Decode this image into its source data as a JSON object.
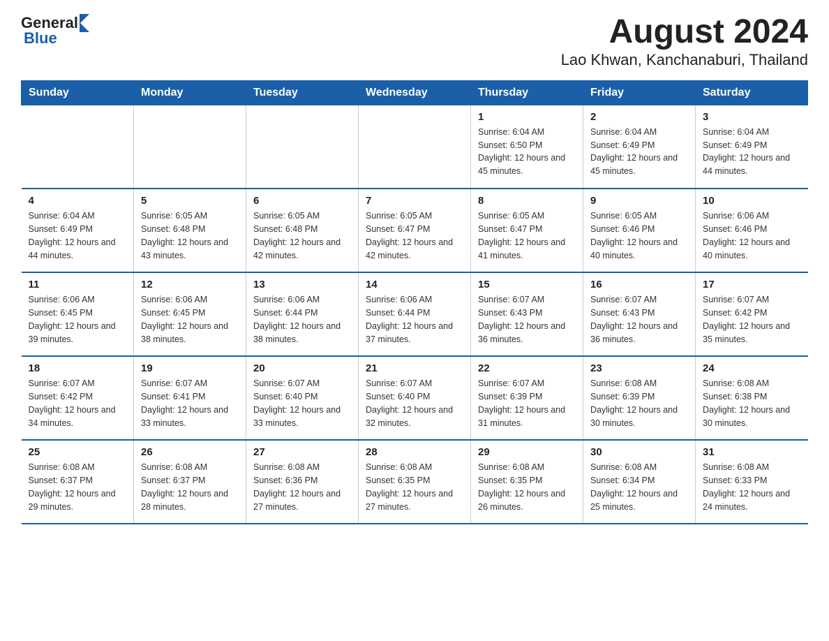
{
  "header": {
    "logo_general": "General",
    "logo_blue": "Blue",
    "title": "August 2024",
    "subtitle": "Lao Khwan, Kanchanaburi, Thailand"
  },
  "days_of_week": [
    "Sunday",
    "Monday",
    "Tuesday",
    "Wednesday",
    "Thursday",
    "Friday",
    "Saturday"
  ],
  "weeks": [
    [
      {
        "day": "",
        "info": ""
      },
      {
        "day": "",
        "info": ""
      },
      {
        "day": "",
        "info": ""
      },
      {
        "day": "",
        "info": ""
      },
      {
        "day": "1",
        "info": "Sunrise: 6:04 AM\nSunset: 6:50 PM\nDaylight: 12 hours and 45 minutes."
      },
      {
        "day": "2",
        "info": "Sunrise: 6:04 AM\nSunset: 6:49 PM\nDaylight: 12 hours and 45 minutes."
      },
      {
        "day": "3",
        "info": "Sunrise: 6:04 AM\nSunset: 6:49 PM\nDaylight: 12 hours and 44 minutes."
      }
    ],
    [
      {
        "day": "4",
        "info": "Sunrise: 6:04 AM\nSunset: 6:49 PM\nDaylight: 12 hours and 44 minutes."
      },
      {
        "day": "5",
        "info": "Sunrise: 6:05 AM\nSunset: 6:48 PM\nDaylight: 12 hours and 43 minutes."
      },
      {
        "day": "6",
        "info": "Sunrise: 6:05 AM\nSunset: 6:48 PM\nDaylight: 12 hours and 42 minutes."
      },
      {
        "day": "7",
        "info": "Sunrise: 6:05 AM\nSunset: 6:47 PM\nDaylight: 12 hours and 42 minutes."
      },
      {
        "day": "8",
        "info": "Sunrise: 6:05 AM\nSunset: 6:47 PM\nDaylight: 12 hours and 41 minutes."
      },
      {
        "day": "9",
        "info": "Sunrise: 6:05 AM\nSunset: 6:46 PM\nDaylight: 12 hours and 40 minutes."
      },
      {
        "day": "10",
        "info": "Sunrise: 6:06 AM\nSunset: 6:46 PM\nDaylight: 12 hours and 40 minutes."
      }
    ],
    [
      {
        "day": "11",
        "info": "Sunrise: 6:06 AM\nSunset: 6:45 PM\nDaylight: 12 hours and 39 minutes."
      },
      {
        "day": "12",
        "info": "Sunrise: 6:06 AM\nSunset: 6:45 PM\nDaylight: 12 hours and 38 minutes."
      },
      {
        "day": "13",
        "info": "Sunrise: 6:06 AM\nSunset: 6:44 PM\nDaylight: 12 hours and 38 minutes."
      },
      {
        "day": "14",
        "info": "Sunrise: 6:06 AM\nSunset: 6:44 PM\nDaylight: 12 hours and 37 minutes."
      },
      {
        "day": "15",
        "info": "Sunrise: 6:07 AM\nSunset: 6:43 PM\nDaylight: 12 hours and 36 minutes."
      },
      {
        "day": "16",
        "info": "Sunrise: 6:07 AM\nSunset: 6:43 PM\nDaylight: 12 hours and 36 minutes."
      },
      {
        "day": "17",
        "info": "Sunrise: 6:07 AM\nSunset: 6:42 PM\nDaylight: 12 hours and 35 minutes."
      }
    ],
    [
      {
        "day": "18",
        "info": "Sunrise: 6:07 AM\nSunset: 6:42 PM\nDaylight: 12 hours and 34 minutes."
      },
      {
        "day": "19",
        "info": "Sunrise: 6:07 AM\nSunset: 6:41 PM\nDaylight: 12 hours and 33 minutes."
      },
      {
        "day": "20",
        "info": "Sunrise: 6:07 AM\nSunset: 6:40 PM\nDaylight: 12 hours and 33 minutes."
      },
      {
        "day": "21",
        "info": "Sunrise: 6:07 AM\nSunset: 6:40 PM\nDaylight: 12 hours and 32 minutes."
      },
      {
        "day": "22",
        "info": "Sunrise: 6:07 AM\nSunset: 6:39 PM\nDaylight: 12 hours and 31 minutes."
      },
      {
        "day": "23",
        "info": "Sunrise: 6:08 AM\nSunset: 6:39 PM\nDaylight: 12 hours and 30 minutes."
      },
      {
        "day": "24",
        "info": "Sunrise: 6:08 AM\nSunset: 6:38 PM\nDaylight: 12 hours and 30 minutes."
      }
    ],
    [
      {
        "day": "25",
        "info": "Sunrise: 6:08 AM\nSunset: 6:37 PM\nDaylight: 12 hours and 29 minutes."
      },
      {
        "day": "26",
        "info": "Sunrise: 6:08 AM\nSunset: 6:37 PM\nDaylight: 12 hours and 28 minutes."
      },
      {
        "day": "27",
        "info": "Sunrise: 6:08 AM\nSunset: 6:36 PM\nDaylight: 12 hours and 27 minutes."
      },
      {
        "day": "28",
        "info": "Sunrise: 6:08 AM\nSunset: 6:35 PM\nDaylight: 12 hours and 27 minutes."
      },
      {
        "day": "29",
        "info": "Sunrise: 6:08 AM\nSunset: 6:35 PM\nDaylight: 12 hours and 26 minutes."
      },
      {
        "day": "30",
        "info": "Sunrise: 6:08 AM\nSunset: 6:34 PM\nDaylight: 12 hours and 25 minutes."
      },
      {
        "day": "31",
        "info": "Sunrise: 6:08 AM\nSunset: 6:33 PM\nDaylight: 12 hours and 24 minutes."
      }
    ]
  ]
}
